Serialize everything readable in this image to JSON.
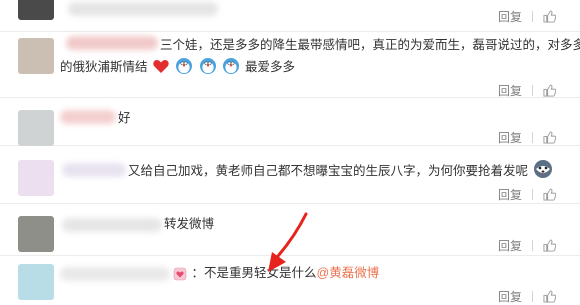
{
  "actions": {
    "reply": "回复",
    "like_icon": "thumbs-up-icon"
  },
  "colors": {
    "link": "#eb7350",
    "meta": "#808080",
    "arrow": "#e8221d"
  },
  "comments": [
    {
      "text": ""
    },
    {
      "text1": "三个娃，还是多多的降生最带感情吧，真正的为爱而生，磊哥说过的，对多多",
      "text2a": "的俄狄浦斯情结",
      "text2b": "最爱多多"
    },
    {
      "text": "好"
    },
    {
      "text": "又给自己加戏，黄老师自己都不想曝宝宝的生辰八字，为何你要抢着发呢"
    },
    {
      "text": "转发微博"
    },
    {
      "text": "：不是重男轻女是什么",
      "mention": "@黄磊微博"
    }
  ]
}
